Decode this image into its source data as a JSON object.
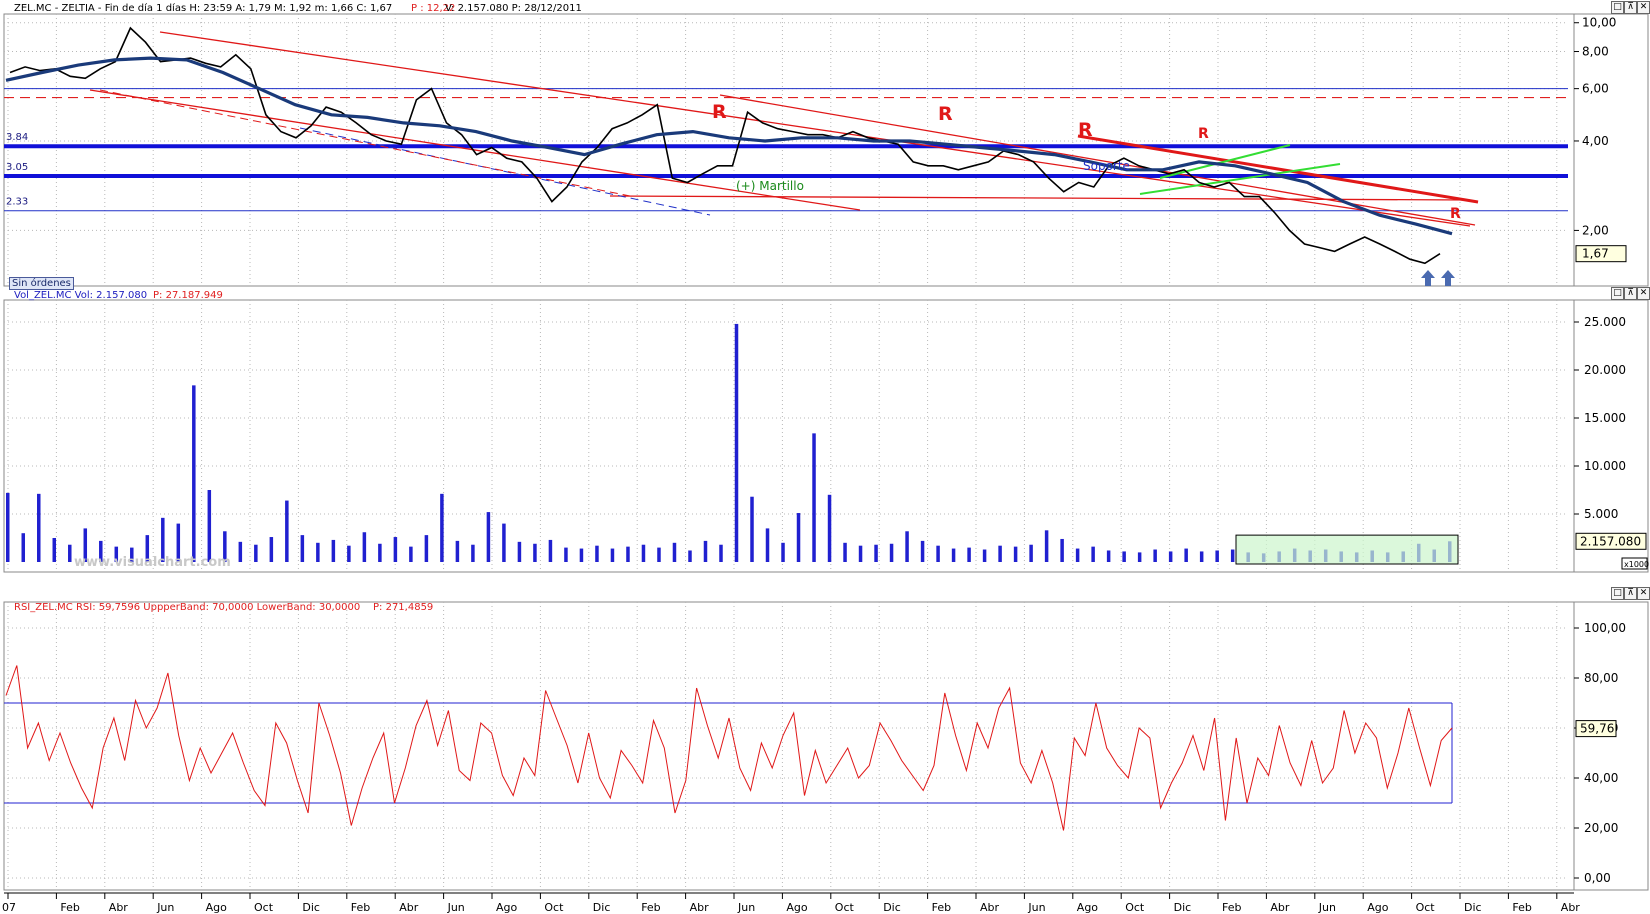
{
  "panels": {
    "price": {
      "header": "ZEL.MC - ZELTIA - Fin de día 1 días  H: 23:59  A: 1,79  M: 1,92  m: 1,66  C: 1,67",
      "header_p": "P : 12,22",
      "header_rest": "V: 2.157.080  P: 28/12/2011",
      "badge_last": "1,67",
      "sin_ordenes": "Sin órdenes",
      "level_labels": [
        "3.84",
        "3.05",
        "2.33"
      ],
      "annotations": {
        "hammer": "(+) Martillo",
        "support": "Soporte"
      }
    },
    "volume": {
      "header": "Vol_ZEL.MC  Vol: 2.157.080",
      "header_p": "P: 27.187.949",
      "badge_last": "2.157.080",
      "multiplier": "x1000",
      "watermark": "www.visualchart.com"
    },
    "rsi": {
      "header": "RSI_ZEL.MC  RSI: 59,7596  UppperBand: 70,0000  LowerBand: 30,0000",
      "header_p": "P: 271,4859",
      "badge_last": "59,76"
    }
  },
  "window_buttons": [
    "□",
    "⊼",
    "✕"
  ],
  "chart_data": [
    {
      "type": "line",
      "title": "ZEL.MC - ZELTIA",
      "y_scale": "log",
      "yticks": [
        "10,00",
        "8,00",
        "6,00",
        "4,00",
        "2,00"
      ],
      "ylim": [
        1.3,
        10.7
      ],
      "horizontal_levels": [
        6.0,
        5.6,
        3.84,
        3.05,
        2.33
      ],
      "x_labels": [
        "07",
        "Feb",
        "Abr",
        "Jun",
        "Ago",
        "Oct",
        "Dic",
        "Feb",
        "Abr",
        "Jun",
        "Ago",
        "Oct",
        "Dic",
        "Feb",
        "Abr",
        "Jun",
        "Ago",
        "Oct",
        "Dic",
        "Feb",
        "Abr",
        "Jun",
        "Ago",
        "Oct",
        "Dic",
        "Feb",
        "Abr",
        "Jun",
        "Ago",
        "Oct",
        "Dic",
        "Feb",
        "Abr"
      ],
      "series": [
        {
          "values": [
            6.8,
            7.1,
            6.9,
            7.0,
            6.6,
            6.5,
            7.0,
            7.4,
            9.6,
            8.6,
            7.4,
            7.5,
            7.6,
            7.3,
            7.1,
            7.8,
            7.0,
            4.9,
            4.3,
            4.1,
            4.5,
            5.2,
            5.0,
            4.6,
            4.2,
            4.0,
            3.9,
            5.5,
            6.0,
            4.6,
            4.2,
            3.6,
            3.8,
            3.5,
            3.4,
            3.0,
            2.5,
            2.8,
            3.4,
            3.8,
            4.4,
            4.6,
            4.9,
            5.3,
            3.0,
            2.9,
            3.1,
            3.3,
            3.3,
            5.0,
            4.6,
            4.4,
            4.3,
            4.2,
            4.2,
            4.1,
            4.3,
            4.1,
            4.0,
            3.9,
            3.4,
            3.3,
            3.3,
            3.2,
            3.3,
            3.4,
            3.7,
            3.6,
            3.4,
            3.0,
            2.7,
            2.9,
            2.8,
            3.3,
            3.5,
            3.3,
            3.2,
            3.1,
            3.2,
            2.9,
            2.8,
            2.9,
            2.6,
            2.6,
            2.3,
            2.0,
            1.8,
            1.75,
            1.7,
            1.8,
            1.9,
            1.8,
            1.7,
            1.6,
            1.55,
            1.67
          ]
        },
        {
          "values": [
            6.4,
            6.8,
            7.2,
            7.5,
            7.6,
            7.5,
            6.8,
            6.0,
            5.3,
            4.9,
            4.8,
            4.6,
            4.5,
            4.3,
            4.0,
            3.8,
            3.6,
            3.9,
            4.2,
            4.3,
            4.1,
            4.0,
            4.1,
            4.1,
            4.0,
            4.0,
            3.9,
            3.8,
            3.7,
            3.6,
            3.4,
            3.2,
            3.2,
            3.4,
            3.3,
            3.1,
            2.9,
            2.5,
            2.25,
            2.1,
            1.95
          ]
        }
      ],
      "annotations": [
        "R",
        "R",
        "R",
        "R",
        "R",
        "R"
      ]
    },
    {
      "type": "bar",
      "title": "Vol_ZEL.MC",
      "yticks": [
        "25.000",
        "20.000",
        "15.000",
        "10.000",
        "5.000"
      ],
      "ylim": [
        0,
        25000
      ],
      "series": [
        {
          "values": [
            7200,
            3000,
            7100,
            2500,
            1800,
            3500,
            2200,
            1600,
            1500,
            2800,
            4600,
            4000,
            18400,
            7500,
            3200,
            2100,
            1800,
            2600,
            6400,
            2800,
            2000,
            2300,
            1700,
            3100,
            1900,
            2600,
            1600,
            2800,
            7100,
            2200,
            1800,
            5200,
            4000,
            2100,
            1900,
            2300,
            1500,
            1400,
            1700,
            1400,
            1600,
            1800,
            1500,
            2000,
            1200,
            2200,
            1800,
            24800,
            6800,
            3500,
            2000,
            5100,
            13400,
            7000,
            2000,
            1700,
            1800,
            1900,
            3200,
            2200,
            1700,
            1400,
            1500,
            1300,
            1700,
            1600,
            1800,
            3300,
            2400,
            1400,
            1600,
            1200,
            1100,
            1000,
            1300,
            1100,
            1400,
            1100,
            1200,
            1300,
            1000,
            900,
            1100,
            1400,
            1200,
            1300,
            1100,
            1000,
            1200,
            1000,
            1100,
            1900,
            1300,
            2157
          ]
        }
      ]
    },
    {
      "type": "line",
      "title": "RSI_ZEL.MC",
      "yticks": [
        "100,00",
        "80,00",
        "60,00",
        "40,00",
        "20,00",
        "0,00"
      ],
      "ylim": [
        -4,
        104
      ],
      "bands": {
        "upper": 70,
        "lower": 30
      },
      "series": [
        {
          "values": [
            73,
            85,
            52,
            62,
            47,
            58,
            46,
            36,
            28,
            52,
            64,
            47,
            71,
            60,
            68,
            82,
            57,
            39,
            52,
            42,
            50,
            58,
            46,
            35,
            29,
            62,
            54,
            39,
            26,
            70,
            57,
            42,
            21,
            36,
            48,
            58,
            30,
            44,
            61,
            71,
            53,
            67,
            43,
            39,
            62,
            58,
            41,
            33,
            48,
            41,
            75,
            64,
            53,
            38,
            58,
            40,
            32,
            51,
            45,
            38,
            63,
            52,
            26,
            39,
            76,
            61,
            48,
            64,
            44,
            35,
            54,
            44,
            57,
            66,
            33,
            51,
            38,
            45,
            52,
            40,
            45,
            62,
            55,
            47,
            41,
            35,
            45,
            74,
            57,
            43,
            62,
            52,
            68,
            76,
            46,
            38,
            51,
            38,
            19,
            56,
            49,
            70,
            52,
            45,
            40,
            60,
            56,
            28,
            38,
            46,
            57,
            43,
            64,
            23,
            56,
            30,
            48,
            41,
            61,
            46,
            37,
            55,
            38,
            44,
            67,
            50,
            62,
            56,
            36,
            50,
            68,
            52,
            37,
            55,
            60
          ]
        }
      ]
    }
  ]
}
